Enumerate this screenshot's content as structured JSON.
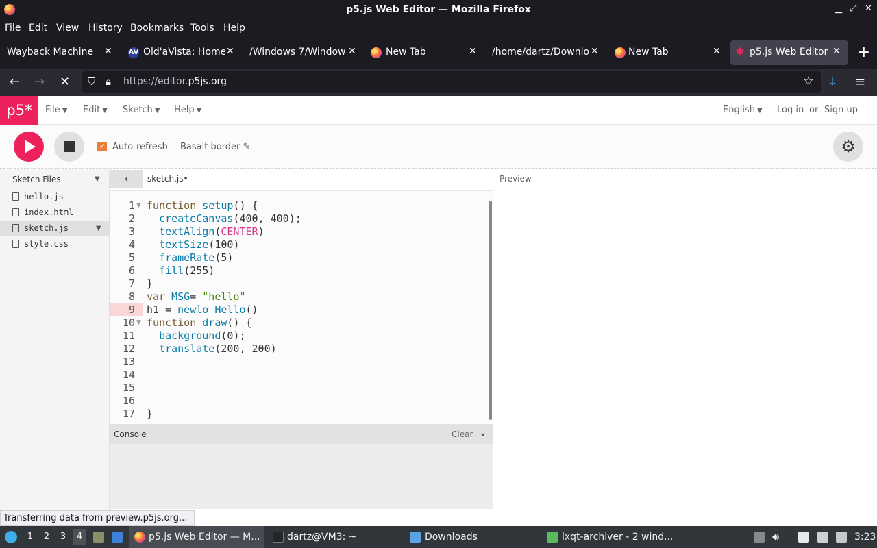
{
  "window": {
    "title": "p5.js Web Editor — Mozilla Firefox"
  },
  "menubar": [
    {
      "label": "File",
      "accel": "F",
      "rest": "ile"
    },
    {
      "label": "Edit",
      "accel": "E",
      "rest": "dit"
    },
    {
      "label": "View",
      "accel": "V",
      "rest": "iew"
    },
    {
      "label": "History",
      "accel": "",
      "rest": "History"
    },
    {
      "label": "Bookmarks",
      "accel": "B",
      "rest": "ookmarks"
    },
    {
      "label": "Tools",
      "accel": "T",
      "rest": "ools"
    },
    {
      "label": "Help",
      "accel": "H",
      "rest": "elp"
    }
  ],
  "tabs": [
    {
      "label": "Wayback Machine",
      "icon": "none"
    },
    {
      "label": "Old'aVista: Home",
      "icon": "av-icon"
    },
    {
      "label": "/Windows 7/Windows",
      "icon": "none"
    },
    {
      "label": "New Tab",
      "icon": "firefox-icon"
    },
    {
      "label": "/home/dartz/Downloa",
      "icon": "none"
    },
    {
      "label": "New Tab",
      "icon": "firefox-icon"
    },
    {
      "label": "p5.js Web Editor",
      "icon": "p5-star-icon"
    }
  ],
  "urlbar": {
    "scheme": "https://editor.",
    "host": "p5js.org"
  },
  "p5": {
    "logo": "p5*",
    "nav": {
      "file": "File",
      "edit": "Edit",
      "sketch": "Sketch",
      "help": "Help"
    },
    "language": "English",
    "login": "Log in",
    "or": "or",
    "signup": "Sign up",
    "auto_refresh": "Auto-refresh",
    "sketch_name": "Basalt border",
    "sidebar_title": "Sketch Files",
    "files": [
      "hello.js",
      "index.html",
      "sketch.js",
      "style.css"
    ],
    "selected_file_index": 2,
    "open_tab": "sketch.js",
    "preview_label": "Preview",
    "console_label": "Console",
    "clear_label": "Clear"
  },
  "code": {
    "line_numbers": [
      "1",
      "2",
      "3",
      "4",
      "5",
      "6",
      "7",
      "8",
      "9",
      "10",
      "11",
      "12",
      "13",
      "14",
      "15",
      "16",
      "17"
    ]
  },
  "status_text": "Transferring data from preview.p5js.org...",
  "taskbar": {
    "desktops": [
      "1",
      "2",
      "3",
      "4"
    ],
    "active_desktop": 4,
    "tasks": [
      "p5.js Web Editor — M...",
      "dartz@VM3: ~",
      "Downloads",
      "lxqt-archiver - 2 wind..."
    ],
    "clock": "3:23"
  }
}
